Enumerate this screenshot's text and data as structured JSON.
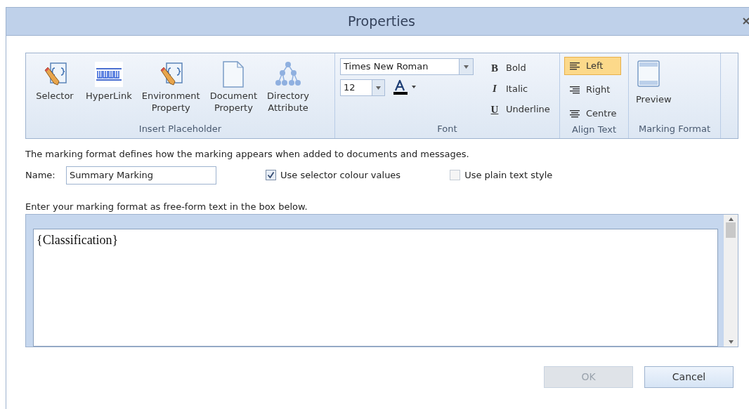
{
  "window": {
    "title": "Properties"
  },
  "ribbon": {
    "groups": [
      {
        "kind": "placeholders",
        "label": "Insert Placeholder",
        "items": [
          {
            "kind": "selector",
            "label": "Selector"
          },
          {
            "kind": "hyperlink",
            "label": "HyperLink"
          },
          {
            "kind": "selector",
            "label": "Environment Property"
          },
          {
            "kind": "document",
            "label": "Document Property"
          },
          {
            "kind": "tree",
            "label": "Directory Attribute"
          }
        ]
      },
      {
        "kind": "font",
        "label": "Font",
        "font_family": "Times New Roman",
        "font_size": "12",
        "styles": [
          {
            "kind": "bold",
            "glyph": "B",
            "label": "Bold"
          },
          {
            "kind": "italic",
            "glyph": "I",
            "label": "Italic"
          },
          {
            "kind": "underline",
            "glyph": "U",
            "label": "Underline"
          }
        ]
      },
      {
        "kind": "align",
        "label": "Align Text",
        "items": [
          {
            "kind": "left",
            "label": "Left",
            "selected": true
          },
          {
            "kind": "right",
            "label": "Right",
            "selected": false
          },
          {
            "kind": "centre",
            "label": "Centre",
            "selected": false
          }
        ]
      },
      {
        "kind": "format",
        "label": "Marking Format",
        "items": [
          {
            "kind": "preview",
            "label": "Preview"
          }
        ]
      }
    ]
  },
  "description": "The marking format defines how the marking appears when added to documents and messages.",
  "name": {
    "label": "Name:",
    "value": "Summary Marking"
  },
  "checkboxes": [
    {
      "label": "Use selector colour values",
      "checked": true
    },
    {
      "label": "Use plain text style",
      "checked": false
    }
  ],
  "editor": {
    "instruction": "Enter your marking format as free-form text in the box below.",
    "text": "{Classification}"
  },
  "buttons": [
    {
      "label": "OK",
      "disabled": true
    },
    {
      "label": "Cancel",
      "disabled": false
    }
  ]
}
